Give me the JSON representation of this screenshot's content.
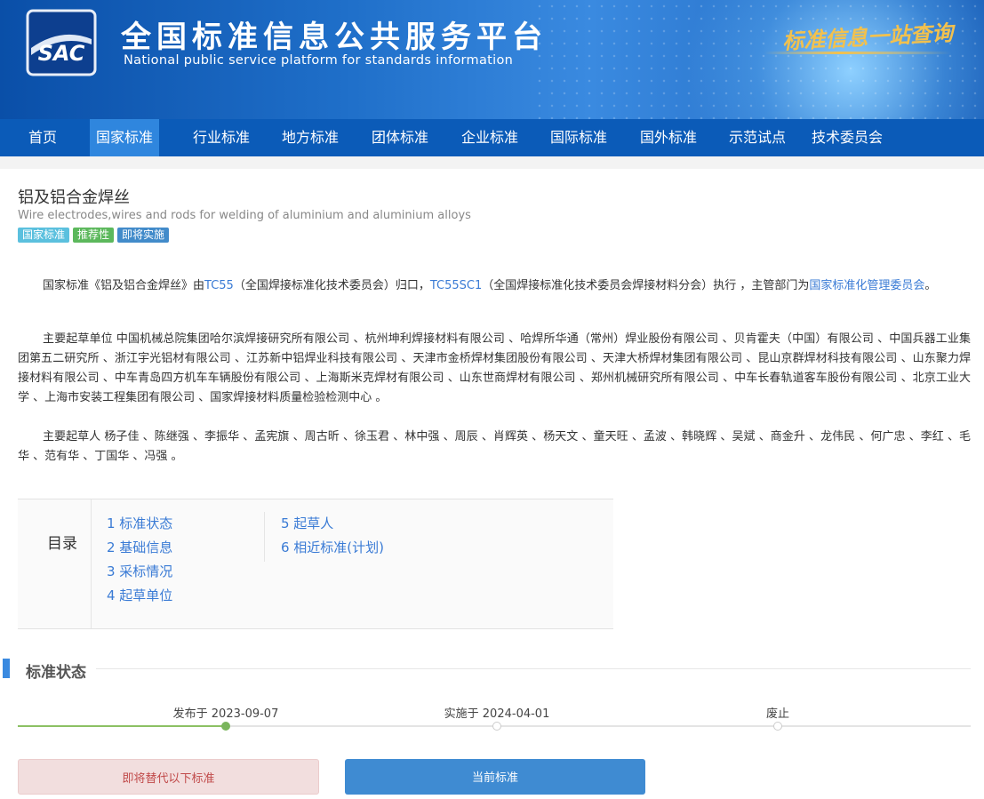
{
  "header": {
    "logo_text": "SAC",
    "title": "全国标准信息公共服务平台",
    "subtitle": "National public service platform  for standards information",
    "slogan": "标准信息一站查询"
  },
  "nav": {
    "items": [
      "首页",
      "国家标准",
      "行业标准",
      "地方标准",
      "团体标准",
      "企业标准",
      "国际标准",
      "国外标准",
      "示范试点",
      "技术委员会"
    ],
    "active_index": 1
  },
  "standard": {
    "title": "铝及铝合金焊丝",
    "title_en": "Wire electrodes,wires and rods for welding of aluminium and aluminium alloys",
    "tags": [
      {
        "label": "国家标准",
        "color": "#5bc0de"
      },
      {
        "label": "推荐性",
        "color": "#5cb85c"
      },
      {
        "label": "即将实施",
        "color": "#428bca"
      }
    ]
  },
  "intro": {
    "p1_a": "国家标准《铝及铝合金焊丝》由",
    "p1_link1": "TC55",
    "p1_b": "（全国焊接标准化技术委员会）归口，",
    "p1_link2": "TC55SC1",
    "p1_c": "（全国焊接标准化技术委员会焊接材料分会）执行 ，主管部门为",
    "p1_link3": "国家标准化管理委员会",
    "p1_d": "。",
    "p2_label": "主要起草单位",
    "p2_text": " 中国机械总院集团哈尔滨焊接研究所有限公司 、杭州坤利焊接材料有限公司 、哈焊所华通（常州）焊业股份有限公司 、贝肯霍夫（中国）有限公司 、中国兵器工业集团第五二研究所 、浙江宇光铝材有限公司 、江苏新中铝焊业科技有限公司 、天津市金桥焊材集团股份有限公司 、天津大桥焊材集团有限公司 、昆山京群焊材科技有限公司 、山东聚力焊接材料有限公司 、中车青岛四方机车车辆股份有限公司 、上海斯米克焊材有限公司 、山东世商焊材有限公司 、郑州机械研究所有限公司 、中车长春轨道客车股份有限公司 、北京工业大学 、上海市安装工程集团有限公司 、国家焊接材料质量检验检测中心 。",
    "p3_label": "主要起草人",
    "p3_text": " 杨子佳 、陈继强 、李振华 、孟宪旗 、周古昕 、徐玉君 、林中强 、周辰 、肖辉英 、杨天文 、童天旺 、孟波 、韩晓辉 、吴斌 、商金升 、龙伟民 、何广忠 、李红 、毛华 、范有华 、丁国华 、冯强 。"
  },
  "toc": {
    "label": "目录",
    "col1": [
      "1 标准状态",
      "2 基础信息",
      "3 采标情况",
      "4 起草单位"
    ],
    "col2": [
      "5 起草人",
      "6 相近标准(计划)"
    ]
  },
  "status": {
    "section_title": "标准状态",
    "timeline": [
      {
        "label": "发布于 2023-09-07",
        "done": true
      },
      {
        "label": "实施于 2024-04-01",
        "done": false
      },
      {
        "label": "废止",
        "done": false
      }
    ],
    "box_replace": "即将替代以下标准",
    "box_current": "当前标准"
  },
  "colors": {
    "nav_bg": "#0b5bb8",
    "nav_active": "#2f86de",
    "link": "#3a7bd5",
    "timeline_done": "#7ab55c"
  }
}
